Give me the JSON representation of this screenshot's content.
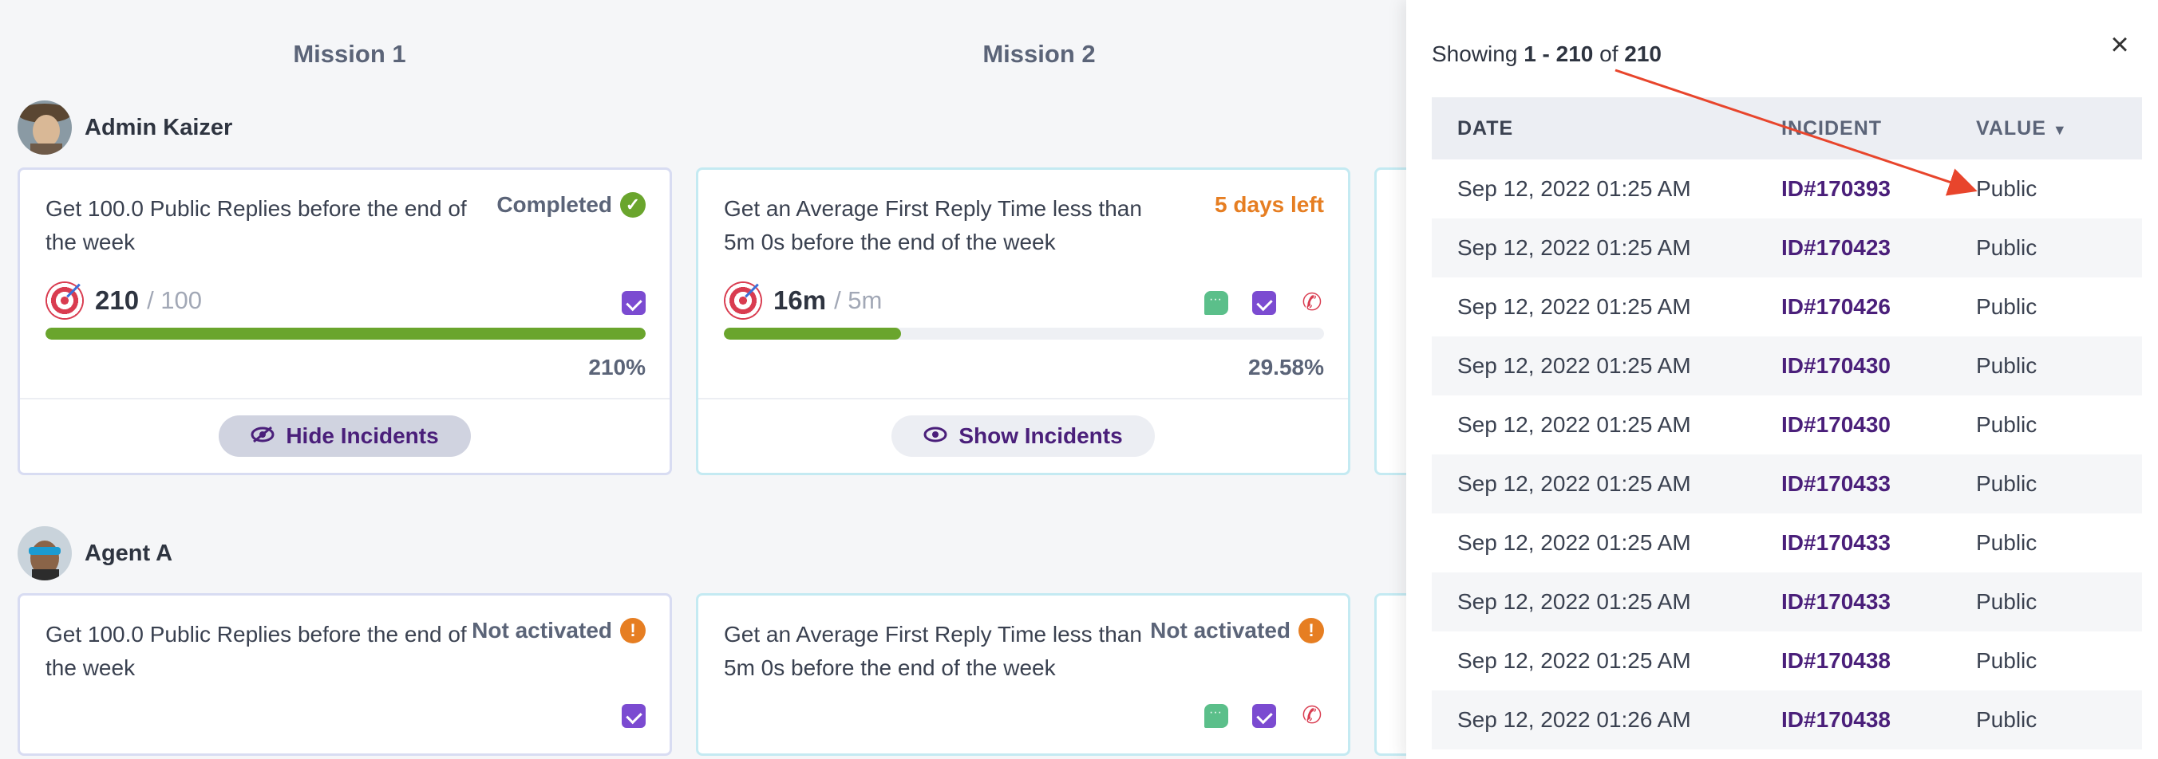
{
  "missions": [
    "Mission 1",
    "Mission 2"
  ],
  "agents": [
    {
      "name": "Admin Kaizer",
      "cards": [
        {
          "description": "Get 100.0 Public Replies before the end of the week",
          "status": "Completed",
          "current": "210",
          "target": "/ 100",
          "percent_label": "210%",
          "progress": 1.0,
          "button": "Hide Incidents"
        },
        {
          "description": "Get an Average First Reply Time less than 5m 0s before the end of the week",
          "status": "5 days left",
          "current": "16m",
          "target": "/ 5m",
          "percent_label": "29.58%",
          "progress": 0.2958,
          "button": "Show Incidents"
        }
      ]
    },
    {
      "name": "Agent A",
      "cards": [
        {
          "description": "Get 100.0 Public Replies before the end of the week",
          "status": "Not activated"
        },
        {
          "description": "Get an Average First Reply Time less than 5m 0s before the end of the week",
          "status": "Not activated"
        }
      ]
    }
  ],
  "panel": {
    "showing_prefix": "Showing",
    "showing_range": "1 - 210",
    "showing_of": "of",
    "showing_total": "210",
    "columns": [
      "DATE",
      "INCIDENT",
      "VALUE"
    ],
    "rows": [
      {
        "date": "Sep 12, 2022 01:25 AM",
        "incident": "ID#170393",
        "value": "Public"
      },
      {
        "date": "Sep 12, 2022 01:25 AM",
        "incident": "ID#170423",
        "value": "Public"
      },
      {
        "date": "Sep 12, 2022 01:25 AM",
        "incident": "ID#170426",
        "value": "Public"
      },
      {
        "date": "Sep 12, 2022 01:25 AM",
        "incident": "ID#170430",
        "value": "Public"
      },
      {
        "date": "Sep 12, 2022 01:25 AM",
        "incident": "ID#170430",
        "value": "Public"
      },
      {
        "date": "Sep 12, 2022 01:25 AM",
        "incident": "ID#170433",
        "value": "Public"
      },
      {
        "date": "Sep 12, 2022 01:25 AM",
        "incident": "ID#170433",
        "value": "Public"
      },
      {
        "date": "Sep 12, 2022 01:25 AM",
        "incident": "ID#170433",
        "value": "Public"
      },
      {
        "date": "Sep 12, 2022 01:25 AM",
        "incident": "ID#170438",
        "value": "Public"
      },
      {
        "date": "Sep 12, 2022 01:26 AM",
        "incident": "ID#170438",
        "value": "Public"
      }
    ]
  },
  "icons": {
    "check": "check-icon",
    "warning": "exclamation-icon",
    "close": "close-icon",
    "eye": "eye-icon",
    "eye_slash": "eye-slash-icon"
  },
  "colors": {
    "accent": "#4a1f7a",
    "success": "#6aa52d",
    "warning": "#e67e22",
    "annotation_arrow": "#e8452c"
  }
}
